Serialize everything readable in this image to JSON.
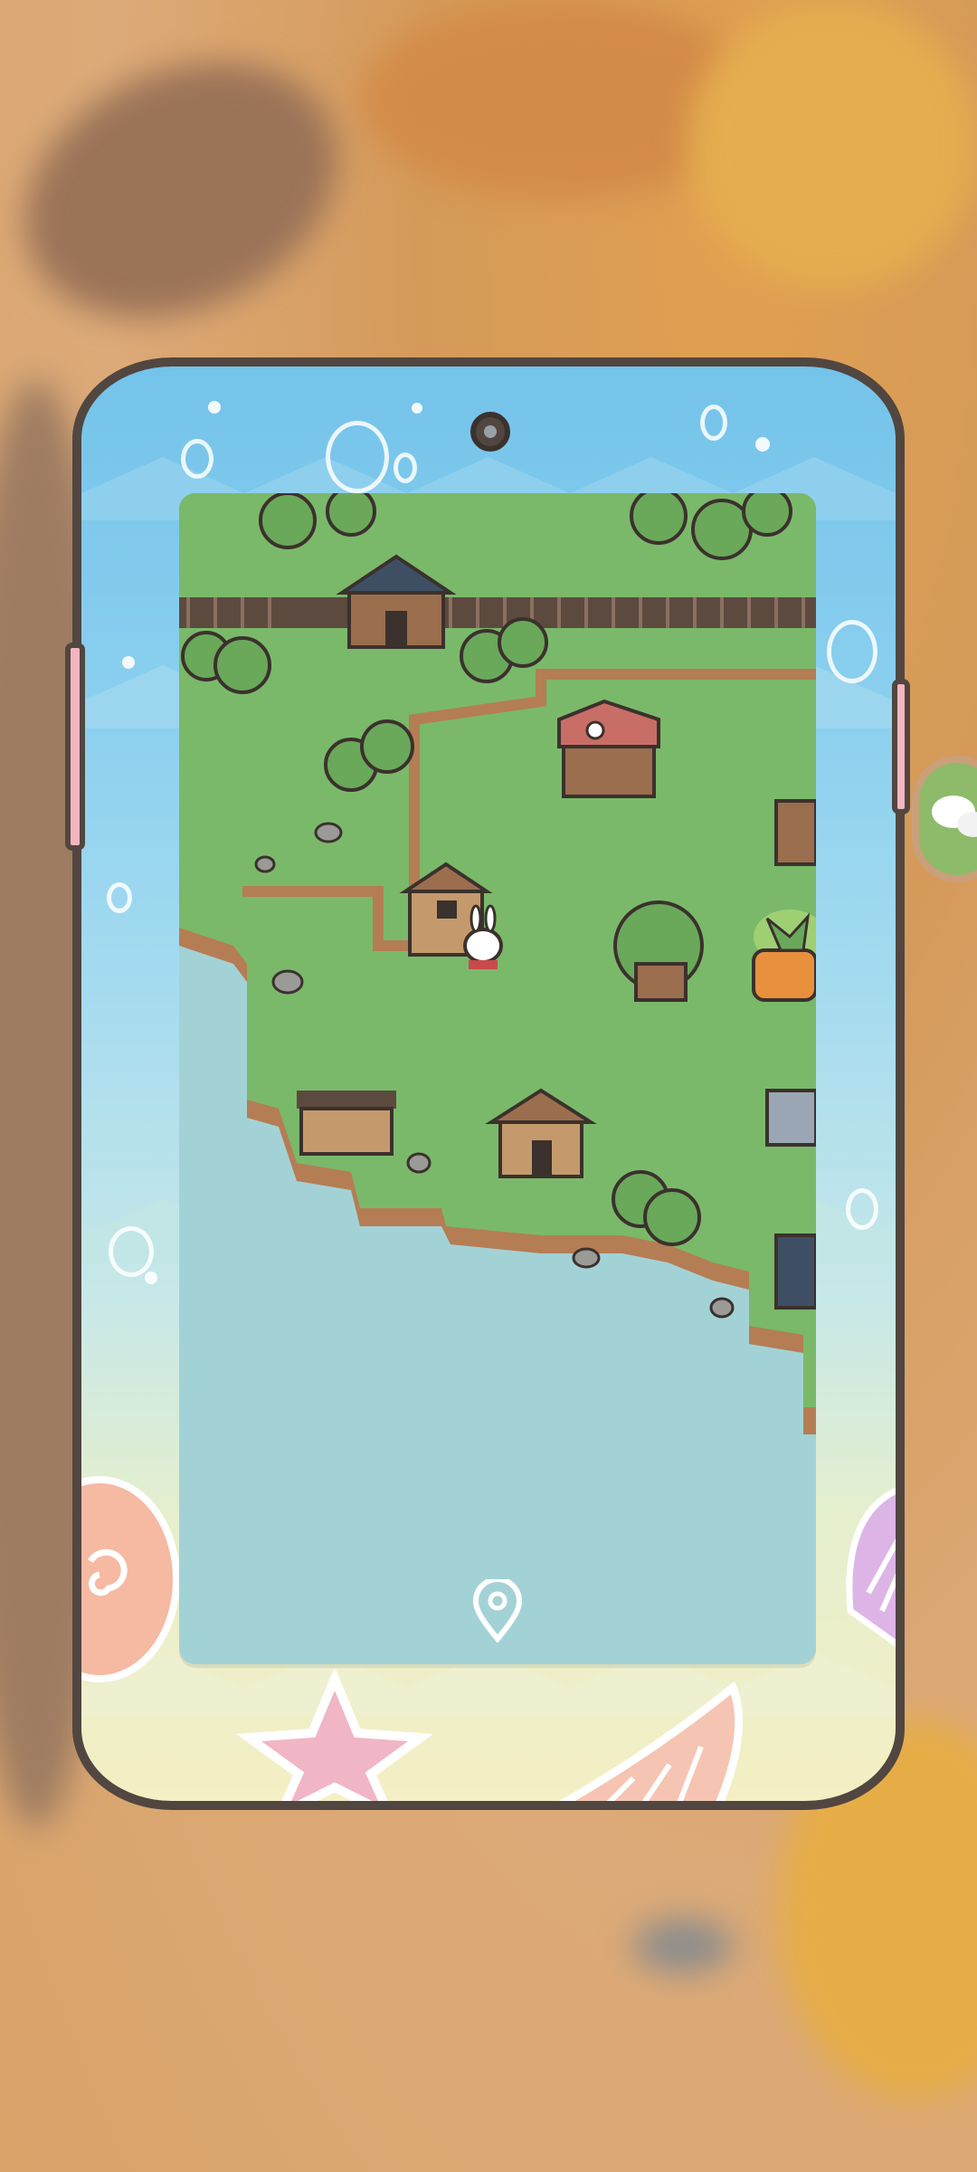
{
  "screen": {
    "title": "",
    "device_frame_color": "#514640",
    "map_colors": {
      "grass": "#7ab96a",
      "water": "#a3d2d6",
      "cliff": "#b57d54"
    }
  },
  "map": {
    "icons": [
      "tree-icon",
      "house-icon",
      "shop-icon",
      "rabbit-character-icon",
      "carrot-house-icon",
      "treehouse-icon",
      "workshop-icon",
      "barn-icon",
      "railroad-icon",
      "rock-icon"
    ],
    "location_pin": "location-pin-icon",
    "side_button": "chat-bubbles-icon"
  }
}
